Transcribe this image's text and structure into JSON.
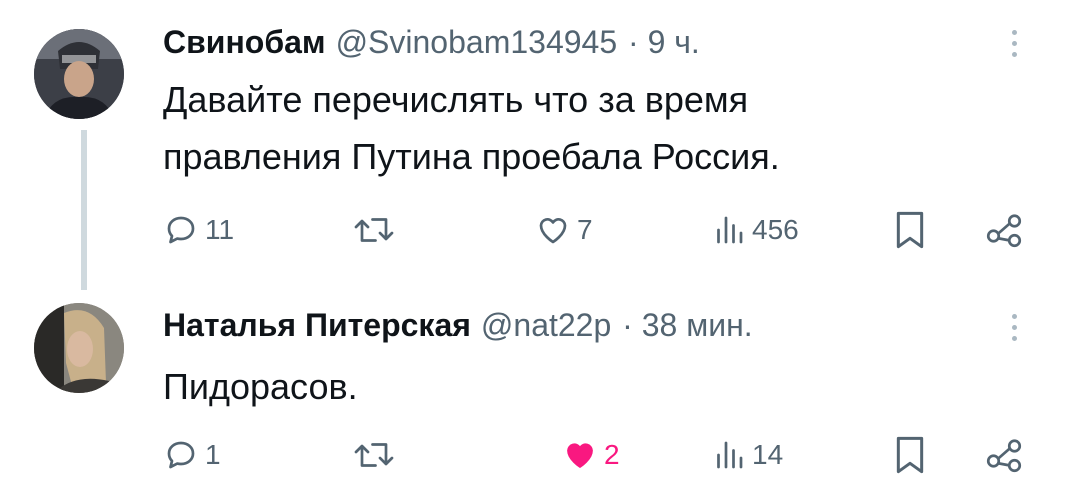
{
  "tweets": [
    {
      "display_name": "Свинобам",
      "handle": "@Svinobam134945",
      "time": "· 9 ч.",
      "text_line1": "Давайте перечислять что за время",
      "text_line2": "правления Путина проебала Россия.",
      "replies": "11",
      "retweets": "",
      "likes": "7",
      "liked": false,
      "views": "456"
    },
    {
      "display_name": "Наталья Питерская",
      "handle": "@nat22p",
      "time": "· 38 мин.",
      "text_line1": "Пидорасов.",
      "replies": "1",
      "retweets": "",
      "likes": "2",
      "liked": true,
      "views": "14"
    }
  ],
  "colors": {
    "text": "#0f1419",
    "muted": "#536471",
    "like_active": "#f91880",
    "thread_line": "#cfd9de"
  },
  "icons": [
    "reply-icon",
    "retweet-icon",
    "like-icon",
    "views-icon",
    "bookmark-icon",
    "share-icon",
    "more-icon"
  ]
}
